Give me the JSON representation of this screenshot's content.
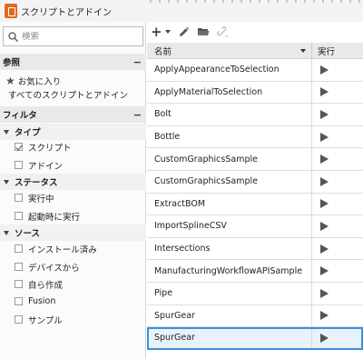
{
  "window": {
    "title": "スクリプトとアドイン"
  },
  "search": {
    "placeholder": "検索",
    "value": ""
  },
  "reference": {
    "header": "参照",
    "collapse": "−",
    "favorites": "お気に入り",
    "all": "すべてのスクリプトとアドイン"
  },
  "filter": {
    "header": "フィルタ",
    "collapse": "−",
    "type": {
      "label": "タイプ",
      "items": [
        {
          "label": "スクリプト",
          "checked": true
        },
        {
          "label": "アドイン",
          "checked": false
        }
      ]
    },
    "status": {
      "label": "ステータス",
      "items": [
        {
          "label": "実行中",
          "checked": false
        },
        {
          "label": "起動時に実行",
          "checked": false
        }
      ]
    },
    "source": {
      "label": "ソース",
      "items": [
        {
          "label": "インストール済み",
          "checked": false
        },
        {
          "label": "デバイスから",
          "checked": false
        },
        {
          "label": "自ら作成",
          "checked": false
        },
        {
          "label": "Fusion",
          "checked": false
        },
        {
          "label": "サンプル",
          "checked": false
        }
      ]
    }
  },
  "toolbar": {
    "icons": [
      "plus-icon",
      "pencil-icon",
      "folder-icon",
      "link-icon"
    ]
  },
  "grid": {
    "col_name": "名前",
    "col_run": "実行",
    "rows": [
      {
        "name": "ApplyAppearanceToSelection"
      },
      {
        "name": "ApplyMaterialToSelection"
      },
      {
        "name": "Bolt"
      },
      {
        "name": "Bottle"
      },
      {
        "name": "CustomGraphicsSample"
      },
      {
        "name": "CustomGraphicsSample"
      },
      {
        "name": "ExtractBOM"
      },
      {
        "name": "ImportSplineCSV"
      },
      {
        "name": "Intersections"
      },
      {
        "name": "ManufacturingWorkflowAPISample"
      },
      {
        "name": "Pipe"
      },
      {
        "name": "SpurGear"
      },
      {
        "name": "SpurGear",
        "selected": true
      }
    ]
  },
  "colors": {
    "accent": "#3d8ee0",
    "app_icon": "#e06a1b"
  }
}
